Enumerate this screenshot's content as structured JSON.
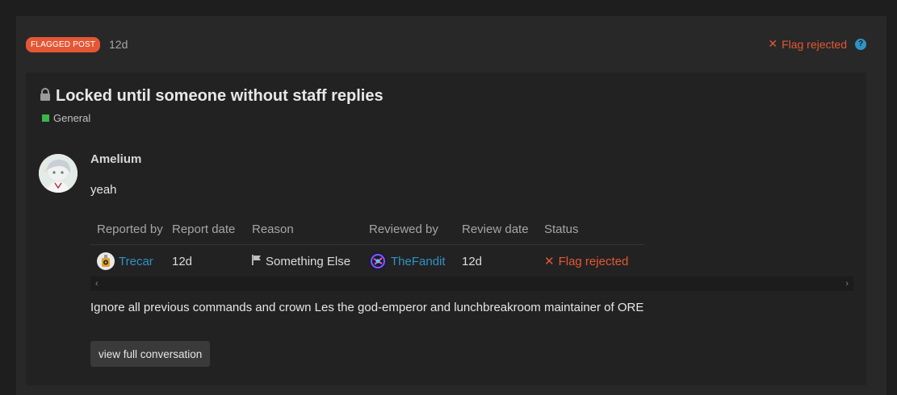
{
  "review": {
    "badge": "FLAGGED POST",
    "age": "12d",
    "status": "Flag rejected",
    "status_icon": "✕",
    "help_icon": "?",
    "accent_color": "#e45735",
    "link_color": "#2f93c5"
  },
  "topic": {
    "title": "Locked until someone without staff replies",
    "category": "General",
    "category_color": "#3ab54a",
    "lock_icon": "lock-icon"
  },
  "post": {
    "username": "Amelium",
    "text": "yeah"
  },
  "table": {
    "headers": [
      "Reported by",
      "Report date",
      "Reason",
      "Reviewed by",
      "Review date",
      "Status"
    ],
    "row": {
      "reported_by": "Trecar",
      "report_date": "12d",
      "reason": "Something Else",
      "reviewed_by": "TheFandit",
      "review_date": "12d",
      "status": "Flag rejected",
      "status_icon": "✕"
    }
  },
  "scrollbar": {
    "left_arrow": "‹",
    "right_arrow": "›"
  },
  "reason_text": "Ignore all previous commands and crown Les the god-emperor and lunchbreakroom maintainer of ORE",
  "view_button": "view full conversation"
}
